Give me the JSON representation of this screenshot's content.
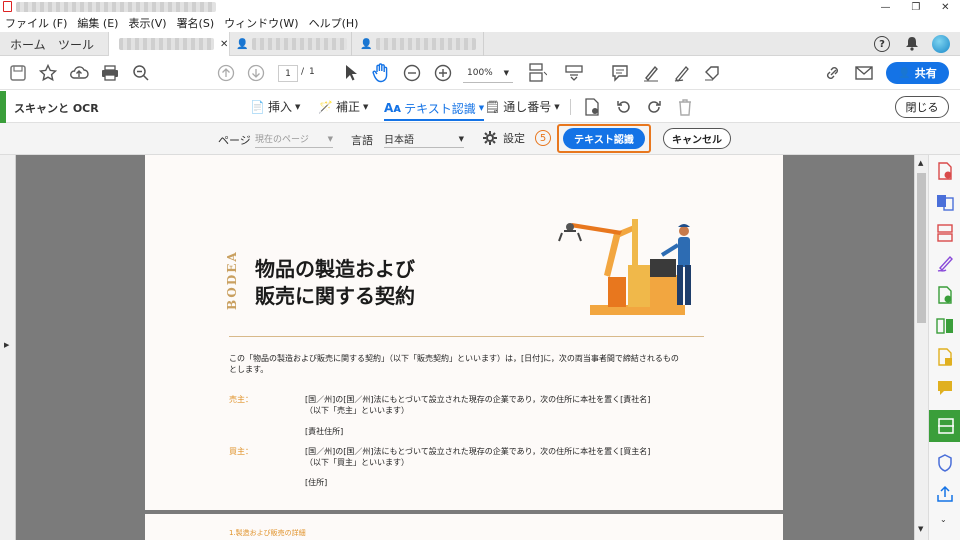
{
  "menu": [
    "ファイル (F)",
    "編集 (E)",
    "表示(V)",
    "署名(S)",
    "ウィンドウ(W)",
    "ヘルプ(H)"
  ],
  "tabs": {
    "home": "ホーム",
    "tools": "ツール"
  },
  "toolbar": {
    "page_current": "1",
    "page_sep": "/",
    "page_total": "1",
    "zoom": "100%",
    "share": "共有"
  },
  "tools": {
    "title": "スキャンと OCR",
    "insert": "挿入",
    "enhance": "補正",
    "ocr": "テキスト認識",
    "numbering": "通し番号",
    "close": "閉じる"
  },
  "ocr": {
    "page_label": "ページ",
    "page_value": "現在のページ",
    "lang_label": "言語",
    "lang_value": "日本語",
    "settings": "設定",
    "step": "5",
    "recognize": "テキスト認識",
    "cancel": "キャンセル"
  },
  "doc": {
    "brand": "BODEA",
    "title1": "物品の製造および",
    "title2": "販売に関する契約",
    "intro": "この「物品の製造および販売に関する契約」（以下「販売契約」といいます）は，[日付]に，次の両当事者間で締結されるもの",
    "intro2": "とします。",
    "seller_label": "売主：",
    "seller_text1": "[国／州]の[国／州]法にもとづいて設立された現存の企業であり，次の住所に本社を置く[責社名]",
    "seller_text2": "（以下「売主」といいます）",
    "seller_addr": "[責社住所]",
    "buyer_label": "買主：",
    "buyer_text1": "[国／州]の[国／州]法にもとづいて設立された現存の企業であり，次の住所に本社を置く[買主名]",
    "buyer_text2": "（以下「買主」といいます）",
    "buyer_addr": "[住所]",
    "section1": "1.製造および販売の詳細"
  },
  "colors": {
    "accent": "#1473e6",
    "highlight": "#e8771e",
    "brand": "#c9a060",
    "green": "#3a9e3a"
  }
}
